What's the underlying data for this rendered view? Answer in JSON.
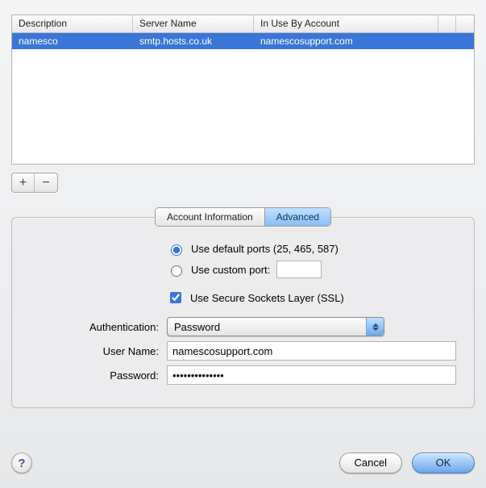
{
  "table": {
    "headers": {
      "description": "Description",
      "server_name": "Server Name",
      "in_use_by": "In Use By Account"
    },
    "rows": [
      {
        "description": "namesco",
        "server_name": "smtp.hosts.co.uk",
        "in_use_by": "namescosupport.com"
      }
    ]
  },
  "buttons": {
    "add": "+",
    "remove": "−",
    "cancel": "Cancel",
    "ok": "OK",
    "help": "?"
  },
  "tabs": {
    "account_info": "Account Information",
    "advanced": "Advanced"
  },
  "form": {
    "use_default_ports": "Use default ports (25, 465, 587)",
    "use_custom_port": "Use custom port:",
    "custom_port_value": "",
    "use_ssl": "Use Secure Sockets Layer (SSL)",
    "authentication_label": "Authentication:",
    "authentication_value": "Password",
    "username_label": "User Name:",
    "username_value": "namescosupport.com",
    "password_label": "Password:",
    "password_value": "••••••••••••••"
  }
}
